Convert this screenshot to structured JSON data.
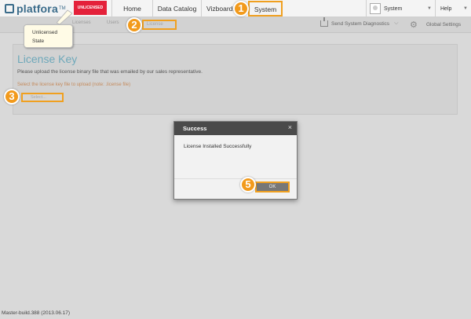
{
  "header": {
    "logo_text": "platfora",
    "logo_tm": "TM",
    "license_badge": "UNLICENSED",
    "nav": {
      "home": "Home",
      "catalog": "Data Catalog",
      "vizboards": "Vizboards",
      "system": "System"
    },
    "user_label": "System",
    "help_label": "Help"
  },
  "subnav": {
    "tabs": [
      "Licenses",
      "Users",
      "License"
    ],
    "diagnostics": "Send System Diagnostics",
    "global_settings": "Global Settings"
  },
  "panel": {
    "title": "License Key",
    "description": "Please upload the license binary file that was emailed by our sales representative.",
    "note": "Select the license key file to upload (note: .license file)",
    "select_button": "Select..."
  },
  "tooltip": {
    "line1": "Unlicensed",
    "line2": "State"
  },
  "badges": {
    "b1": "1",
    "b2": "2",
    "b3": "3",
    "b5": "5"
  },
  "modal": {
    "title": "Success",
    "close": "×",
    "message": "License Installed Successfully",
    "ok_button": "OK"
  },
  "footer": {
    "build": "Master-build.388 (2013.06.17)"
  },
  "colors": {
    "accent": "#f0a020",
    "badge": "#e4213a",
    "title": "#6ea8ba"
  },
  "icons": {
    "close": "close-icon",
    "gear": "gear-icon",
    "diagnostics": "upload-icon"
  }
}
